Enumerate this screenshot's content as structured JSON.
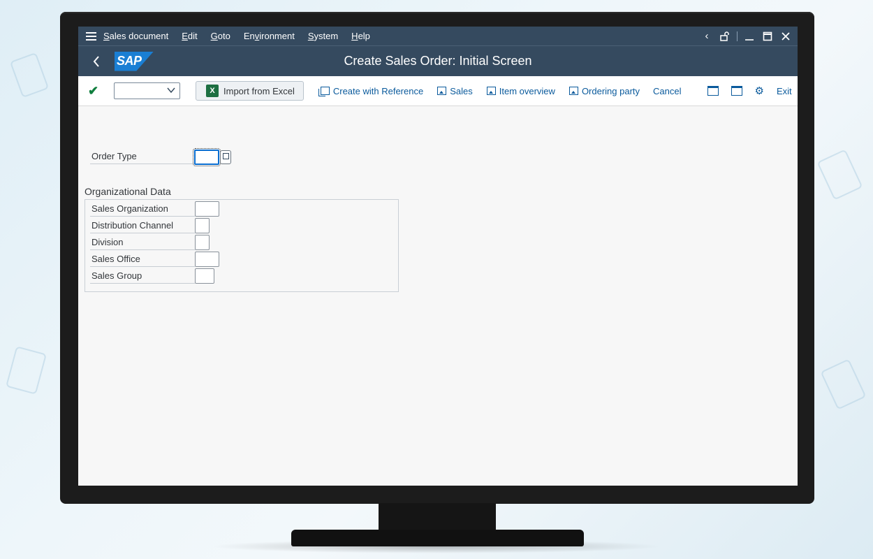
{
  "menubar": {
    "items": [
      {
        "label": "Sales document"
      },
      {
        "label": "Edit"
      },
      {
        "label": "Goto"
      },
      {
        "label": "Environment"
      },
      {
        "label": "System"
      },
      {
        "label": "Help"
      }
    ]
  },
  "titlebar": {
    "logo_text": "SAP",
    "title": "Create Sales Order: Initial Screen"
  },
  "toolbar": {
    "command_field_value": "",
    "import_excel_label": "Import from Excel",
    "create_with_reference_label": "Create with Reference",
    "sales_label": "Sales",
    "item_overview_label": "Item overview",
    "ordering_party_label": "Ordering party",
    "cancel_label": "Cancel",
    "exit_label": "Exit"
  },
  "form": {
    "order_type": {
      "label": "Order Type",
      "value": ""
    },
    "org_data_title": "Organizational Data",
    "fields": [
      {
        "label": "Sales Organization",
        "value": ""
      },
      {
        "label": "Distribution Channel",
        "value": ""
      },
      {
        "label": "Division",
        "value": ""
      },
      {
        "label": "Sales Office",
        "value": ""
      },
      {
        "label": "Sales Group",
        "value": ""
      }
    ]
  },
  "colors": {
    "shell": "#354a5f",
    "accent": "#0a6ed1",
    "link": "#0a5a9c",
    "success": "#107e3e",
    "excel": "#1d6f42"
  }
}
